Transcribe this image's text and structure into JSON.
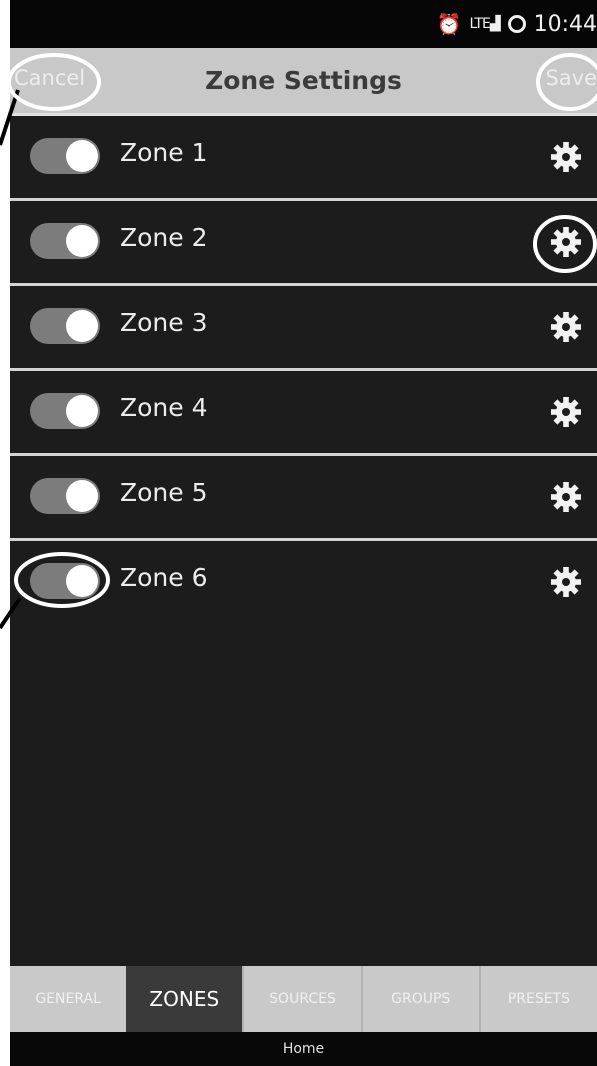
{
  "status_bar": {
    "alarm_icon": "alarm-clock-icon",
    "signal_label": "LTE",
    "time": "10:44"
  },
  "header": {
    "title": "Zone Settings",
    "cancel_label": "Cancel",
    "save_label": "Save"
  },
  "zones": [
    {
      "label": "Zone 1",
      "enabled": true
    },
    {
      "label": "Zone 2",
      "enabled": true
    },
    {
      "label": "Zone 3",
      "enabled": true
    },
    {
      "label": "Zone 4",
      "enabled": true
    },
    {
      "label": "Zone 5",
      "enabled": true
    },
    {
      "label": "Zone 6",
      "enabled": true
    }
  ],
  "tabs": [
    {
      "label": "GENERAL",
      "active": false
    },
    {
      "label": "ZONES",
      "active": true
    },
    {
      "label": "SOURCES",
      "active": false
    },
    {
      "label": "GROUPS",
      "active": false
    },
    {
      "label": "PRESETS",
      "active": false
    }
  ],
  "nav": {
    "home_label": "Home"
  },
  "colors": {
    "background": "#1c1c1c",
    "header_bar": "#c8c8c8",
    "active_tab": "#3a3a3a",
    "toggle_track": "#7c7c7c",
    "annotation_outline": "#ffffff"
  }
}
